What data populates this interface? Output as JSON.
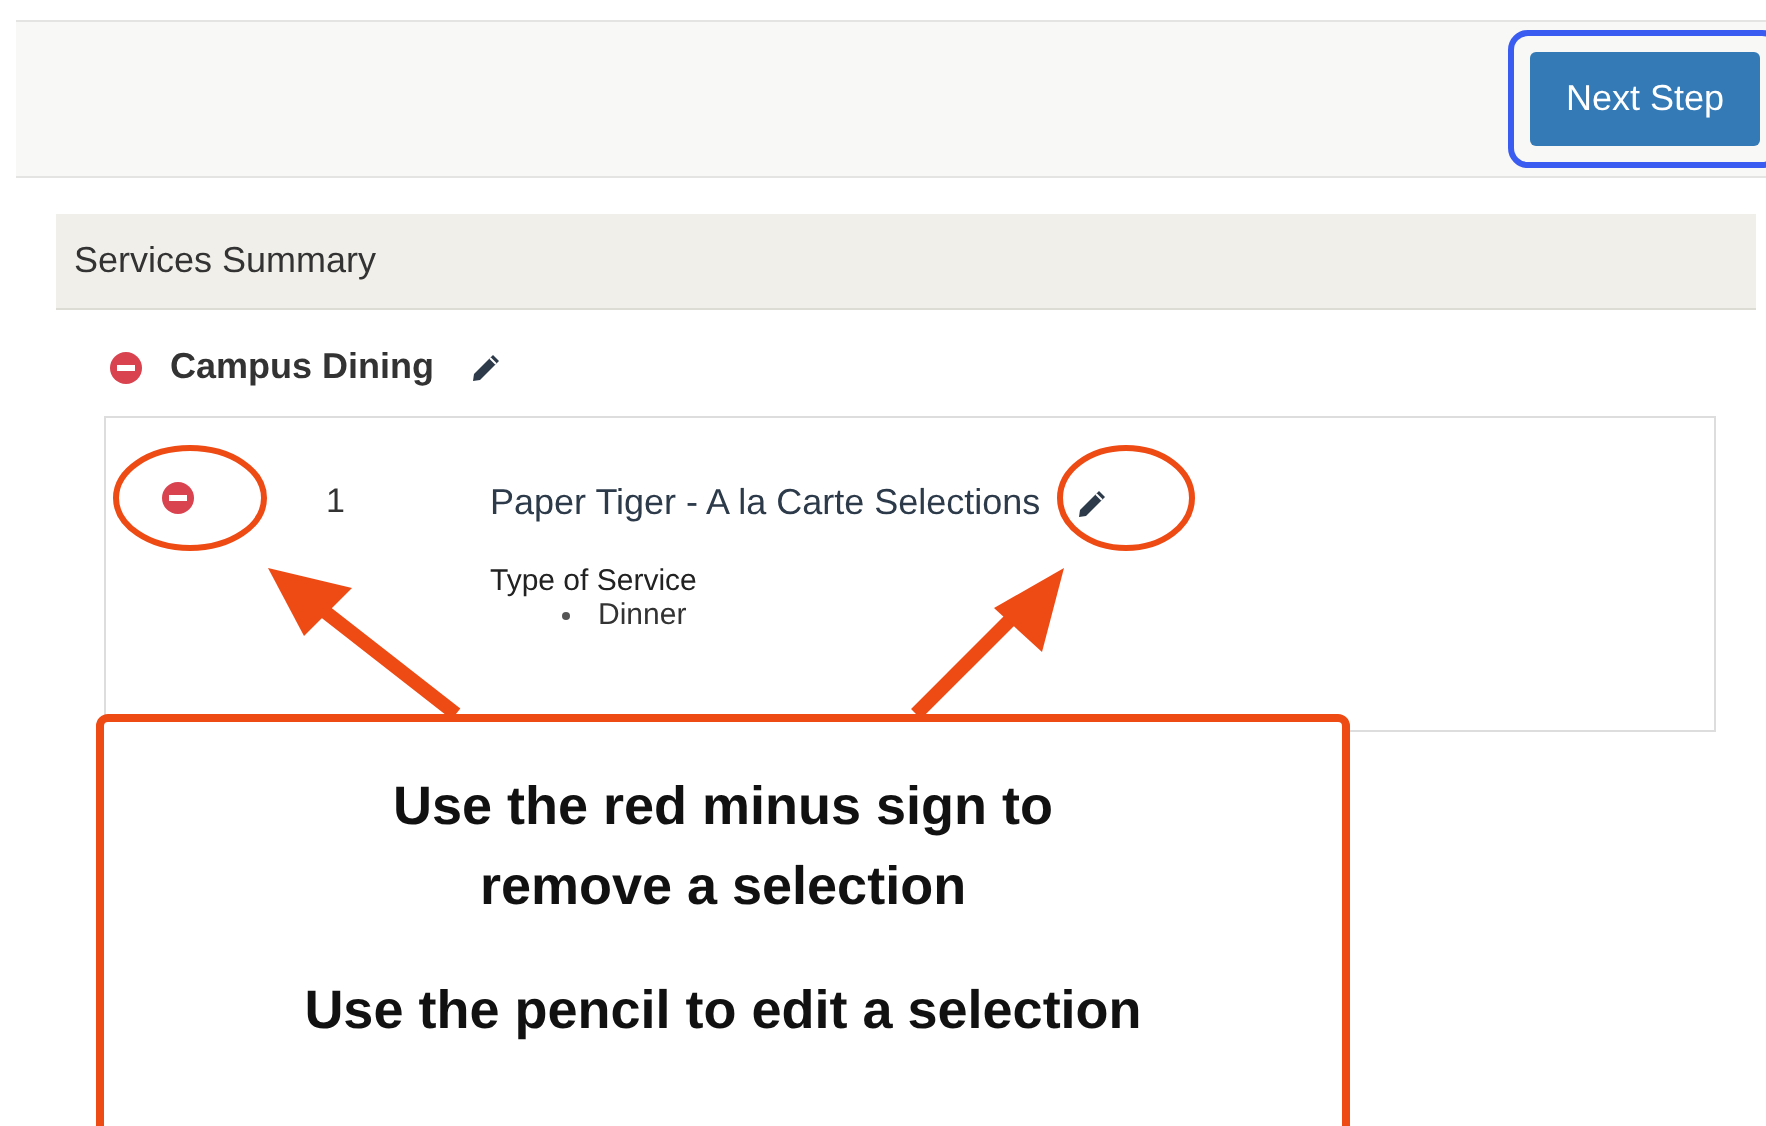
{
  "toolbar": {
    "next_button": "Next Step",
    "focused": true
  },
  "panel": {
    "title": "Services Summary",
    "group": {
      "name": "Campus Dining",
      "items": [
        {
          "number": "1",
          "name": "Paper Tiger - A la Carte Selections",
          "detail_label": "Type of Service",
          "detail_values": [
            "Dinner"
          ]
        }
      ]
    }
  },
  "callout": {
    "paragraphs": [
      [
        "Use the red minus sign to",
        "remove a selection"
      ],
      [
        "Use the pencil to edit a selection"
      ]
    ]
  }
}
